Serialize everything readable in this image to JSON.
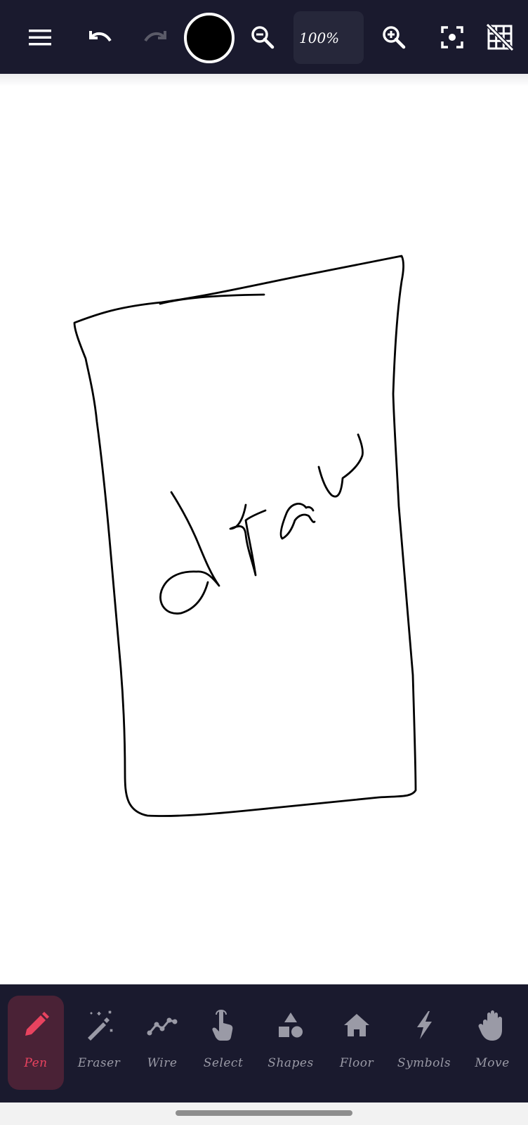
{
  "toolbar": {
    "menu_icon": "hamburger-menu-icon",
    "undo_icon": "undo-icon",
    "redo_icon": "redo-icon",
    "stroke_color": "#000000",
    "zoom_out_icon": "zoom-out-icon",
    "zoom_level": "100%",
    "zoom_in_icon": "zoom-in-icon",
    "fit_screen_icon": "center-focus-icon",
    "grid_off_icon": "grid-off-icon",
    "background": "#1a1a2e"
  },
  "tools": [
    {
      "label": "Pen",
      "icon": "pencil-icon",
      "active": true
    },
    {
      "label": "Eraser",
      "icon": "magic-wand-icon",
      "active": false
    },
    {
      "label": "Wire",
      "icon": "polyline-icon",
      "active": false
    },
    {
      "label": "Select",
      "icon": "pointer-hand-icon",
      "active": false
    },
    {
      "label": "Shapes",
      "icon": "shapes-icon",
      "active": false
    },
    {
      "label": "Floor",
      "icon": "house-icon",
      "active": false
    },
    {
      "label": "Symbols",
      "icon": "lightning-icon",
      "active": false
    },
    {
      "label": "Move",
      "icon": "hand-icon",
      "active": false
    }
  ],
  "colors": {
    "accent": "#e8435f",
    "active_bg": "#4a2236",
    "inactive": "#9a9aa6"
  }
}
